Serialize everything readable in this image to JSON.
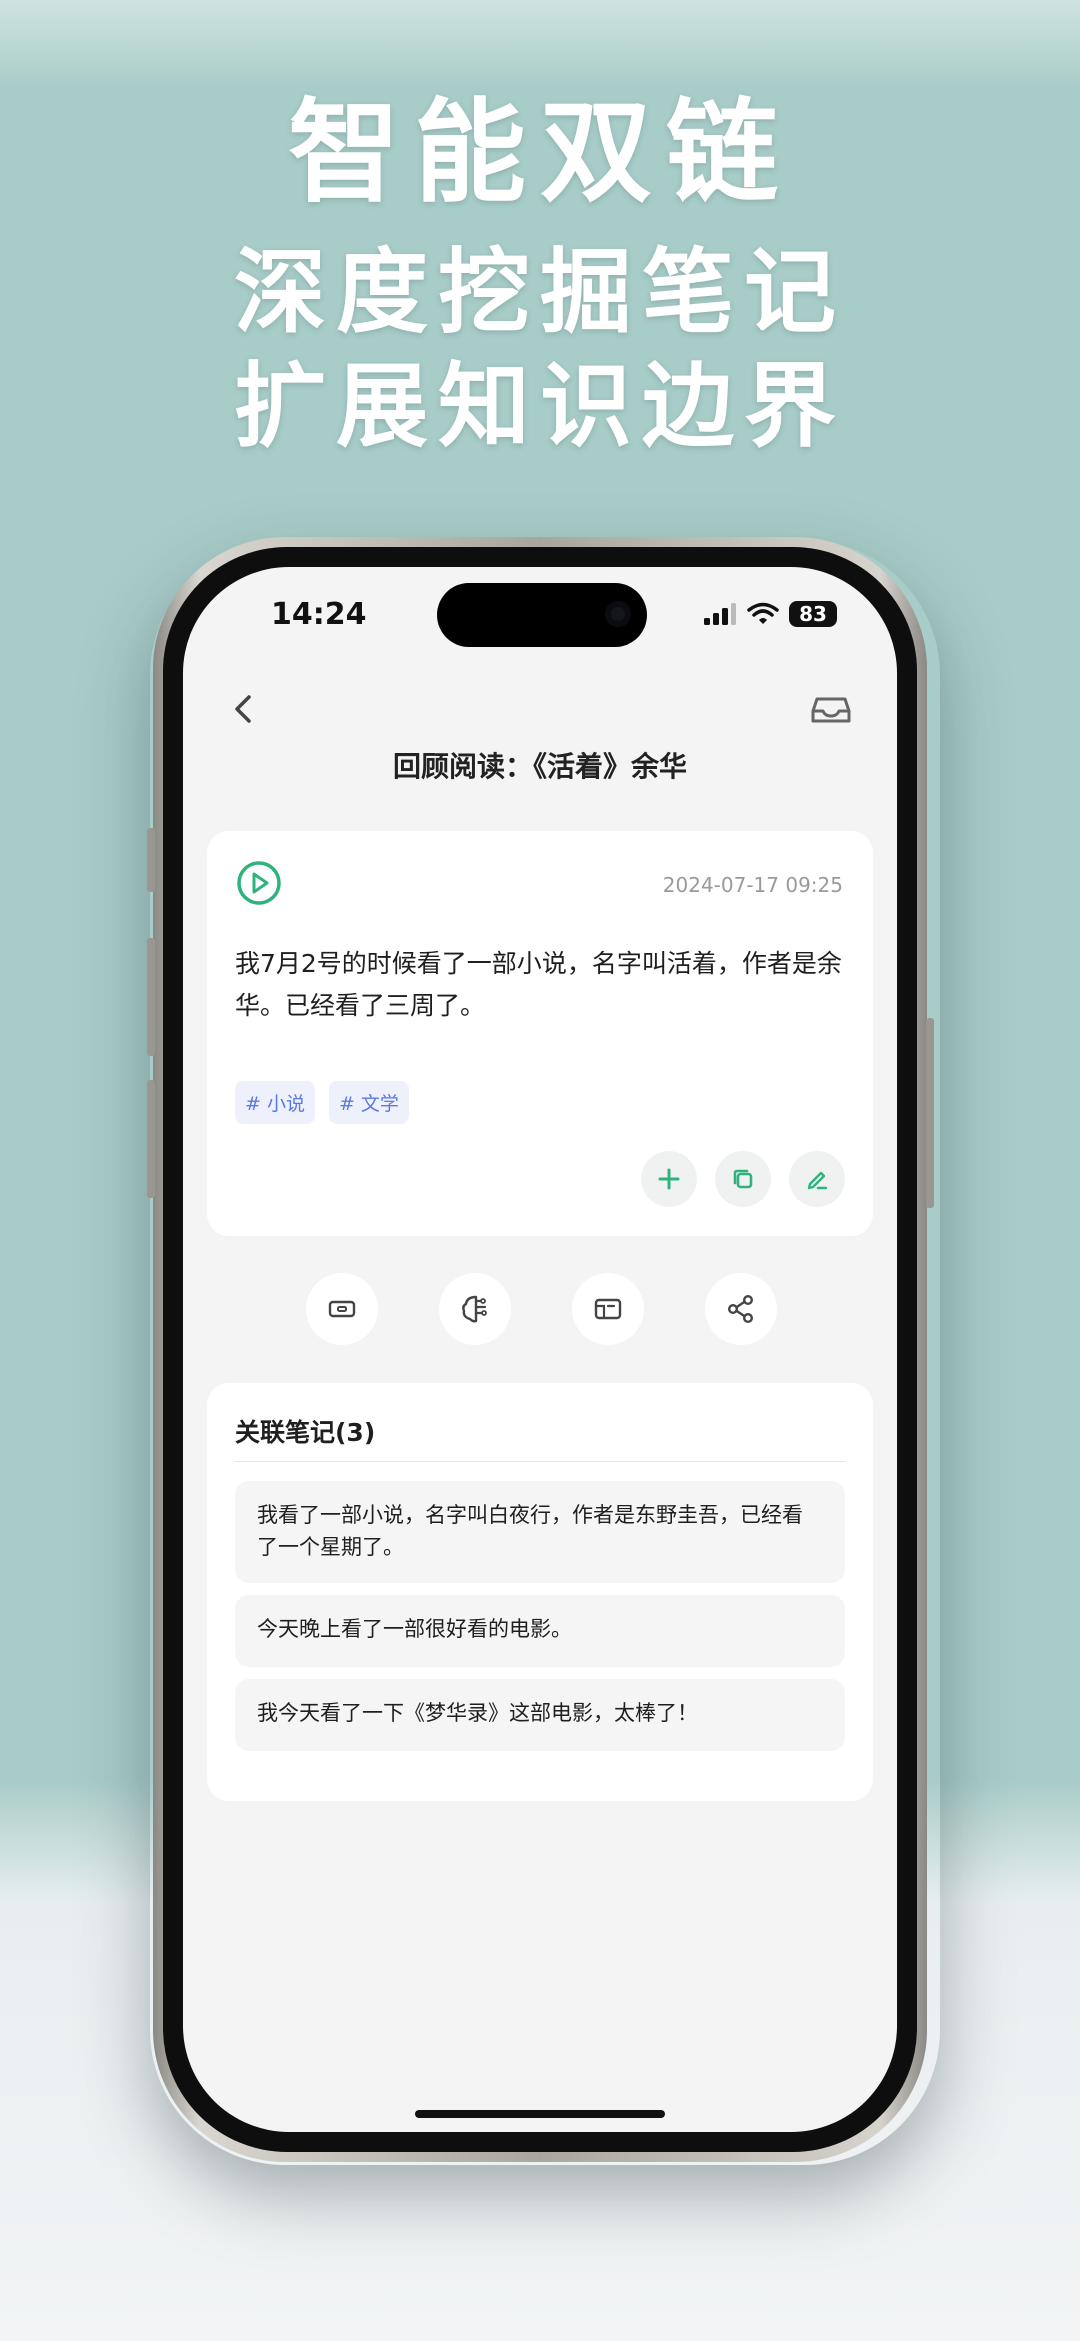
{
  "headline": {
    "line1": "智能双链",
    "line2": "深度挖掘笔记",
    "line3": "扩展知识边界"
  },
  "status_bar": {
    "time": "14:24",
    "battery": "83"
  },
  "nav": {
    "back_icon": "chevron-left-icon",
    "inbox_icon": "inbox-icon",
    "title": "回顾阅读：《活着》余华"
  },
  "note": {
    "timestamp": "2024-07-17 09:25",
    "text": "我7月2号的时候看了一部小说，名字叫活着，作者是余华。已经看了三周了。",
    "tags": [
      "# 小说",
      "# 文学"
    ],
    "actions": [
      "plus-icon",
      "copy-icon",
      "edit-icon"
    ]
  },
  "tools": [
    "ticket-icon",
    "brain-icon",
    "card-icon",
    "share-icon"
  ],
  "related": {
    "title": "关联笔记(3)",
    "items": [
      "我看了一部小说，名字叫白夜行，作者是东野圭吾，已经看了一个星期了。",
      "今天晚上看了一部很好看的电影。",
      "我今天看了一下《梦华录》这部电影，太棒了！"
    ]
  },
  "colors": {
    "accent_green": "#2fb37c",
    "tag_blue": "#5b79e4",
    "background": "#a8ccc8"
  }
}
